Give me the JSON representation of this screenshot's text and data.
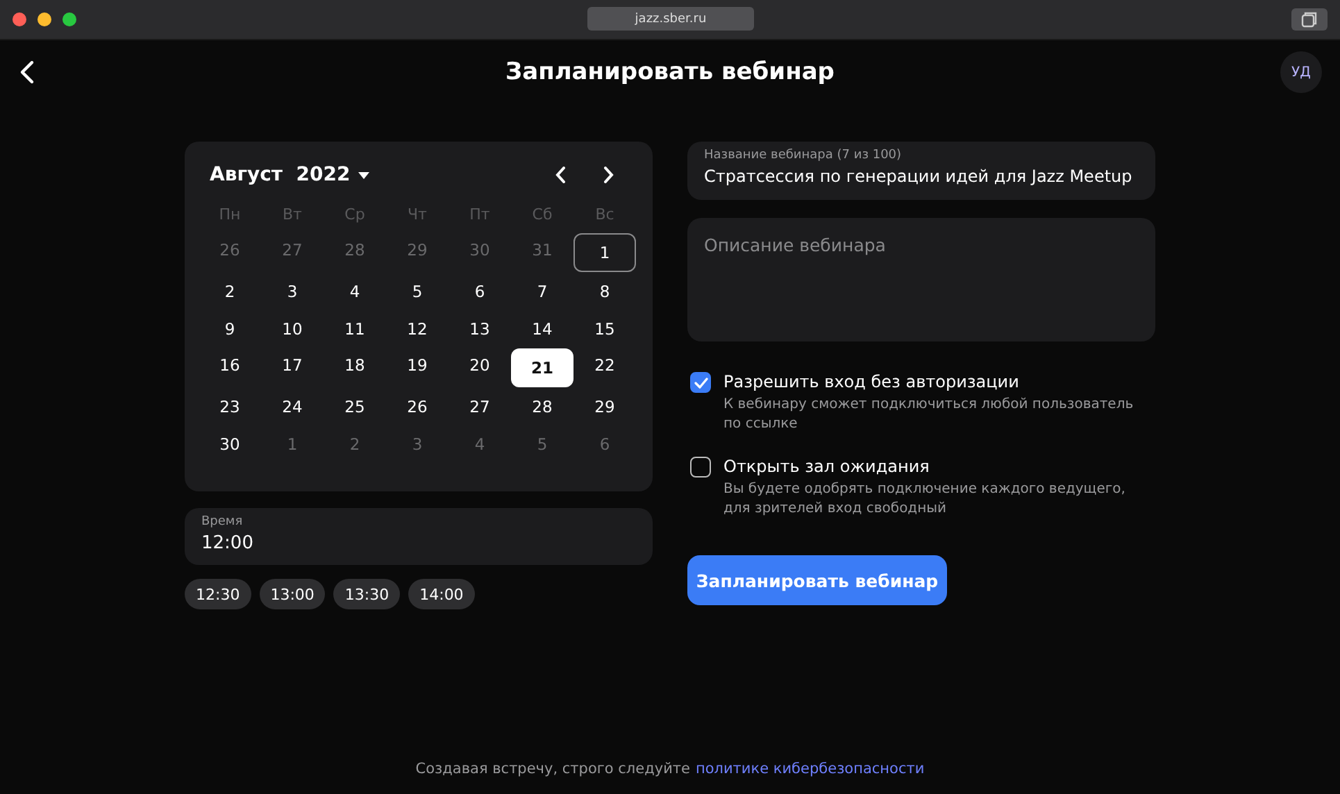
{
  "window": {
    "url": "jazz.sber.ru"
  },
  "header": {
    "title": "Запланировать вебинар",
    "avatar": "УД"
  },
  "calendar": {
    "month": "Август",
    "year": "2022",
    "weekdays": [
      "Пн",
      "Вт",
      "Ср",
      "Чт",
      "Пт",
      "Сб",
      "Вс"
    ],
    "weeks": [
      [
        {
          "label": "26",
          "outside": true,
          "selected": false,
          "today": false
        },
        {
          "label": "27",
          "outside": true,
          "selected": false,
          "today": false
        },
        {
          "label": "28",
          "outside": true,
          "selected": false,
          "today": false
        },
        {
          "label": "29",
          "outside": true,
          "selected": false,
          "today": false
        },
        {
          "label": "30",
          "outside": true,
          "selected": false,
          "today": false
        },
        {
          "label": "31",
          "outside": true,
          "selected": false,
          "today": false
        },
        {
          "label": "1",
          "outside": false,
          "selected": false,
          "today": true
        }
      ],
      [
        {
          "label": "2",
          "outside": false,
          "selected": false,
          "today": false
        },
        {
          "label": "3",
          "outside": false,
          "selected": false,
          "today": false
        },
        {
          "label": "4",
          "outside": false,
          "selected": false,
          "today": false
        },
        {
          "label": "5",
          "outside": false,
          "selected": false,
          "today": false
        },
        {
          "label": "6",
          "outside": false,
          "selected": false,
          "today": false
        },
        {
          "label": "7",
          "outside": false,
          "selected": false,
          "today": false
        },
        {
          "label": "8",
          "outside": false,
          "selected": false,
          "today": false
        }
      ],
      [
        {
          "label": "9",
          "outside": false,
          "selected": false,
          "today": false
        },
        {
          "label": "10",
          "outside": false,
          "selected": false,
          "today": false
        },
        {
          "label": "11",
          "outside": false,
          "selected": false,
          "today": false
        },
        {
          "label": "12",
          "outside": false,
          "selected": false,
          "today": false
        },
        {
          "label": "13",
          "outside": false,
          "selected": false,
          "today": false
        },
        {
          "label": "14",
          "outside": false,
          "selected": false,
          "today": false
        },
        {
          "label": "15",
          "outside": false,
          "selected": false,
          "today": false
        }
      ],
      [
        {
          "label": "16",
          "outside": false,
          "selected": false,
          "today": false
        },
        {
          "label": "17",
          "outside": false,
          "selected": false,
          "today": false
        },
        {
          "label": "18",
          "outside": false,
          "selected": false,
          "today": false
        },
        {
          "label": "19",
          "outside": false,
          "selected": false,
          "today": false
        },
        {
          "label": "20",
          "outside": false,
          "selected": false,
          "today": false
        },
        {
          "label": "21",
          "outside": false,
          "selected": true,
          "today": false
        },
        {
          "label": "22",
          "outside": false,
          "selected": false,
          "today": false
        }
      ],
      [
        {
          "label": "23",
          "outside": false,
          "selected": false,
          "today": false
        },
        {
          "label": "24",
          "outside": false,
          "selected": false,
          "today": false
        },
        {
          "label": "25",
          "outside": false,
          "selected": false,
          "today": false
        },
        {
          "label": "26",
          "outside": false,
          "selected": false,
          "today": false
        },
        {
          "label": "27",
          "outside": false,
          "selected": false,
          "today": false
        },
        {
          "label": "28",
          "outside": false,
          "selected": false,
          "today": false
        },
        {
          "label": "29",
          "outside": false,
          "selected": false,
          "today": false
        }
      ],
      [
        {
          "label": "30",
          "outside": false,
          "selected": false,
          "today": false
        },
        {
          "label": "1",
          "outside": true,
          "selected": false,
          "today": false
        },
        {
          "label": "2",
          "outside": true,
          "selected": false,
          "today": false
        },
        {
          "label": "3",
          "outside": true,
          "selected": false,
          "today": false
        },
        {
          "label": "4",
          "outside": true,
          "selected": false,
          "today": false
        },
        {
          "label": "5",
          "outside": true,
          "selected": false,
          "today": false
        },
        {
          "label": "6",
          "outside": true,
          "selected": false,
          "today": false
        }
      ]
    ]
  },
  "time": {
    "label": "Время",
    "value": "12:00",
    "suggestions": [
      "12:30",
      "13:00",
      "13:30",
      "14:00"
    ]
  },
  "name_field": {
    "label": "Название вебинара (7 из 100)",
    "value": "Стратсессия по генерации идей для Jazz Meetup"
  },
  "description_field": {
    "placeholder": "Описание вебинара"
  },
  "options": [
    {
      "label": "Разрешить вход без авторизации",
      "hint": "К вебинару сможет подключиться любой пользователь по ссылке",
      "checked": true
    },
    {
      "label": "Открыть зал ожидания",
      "hint": "Вы будете одобрять подключение каждого ведущего, для зрителей вход свободный",
      "checked": false
    }
  ],
  "submit": "Запланировать вебинар",
  "footer": {
    "text": "Создавая встречу, строго следуйте",
    "link": "политике кибербезопасности"
  }
}
